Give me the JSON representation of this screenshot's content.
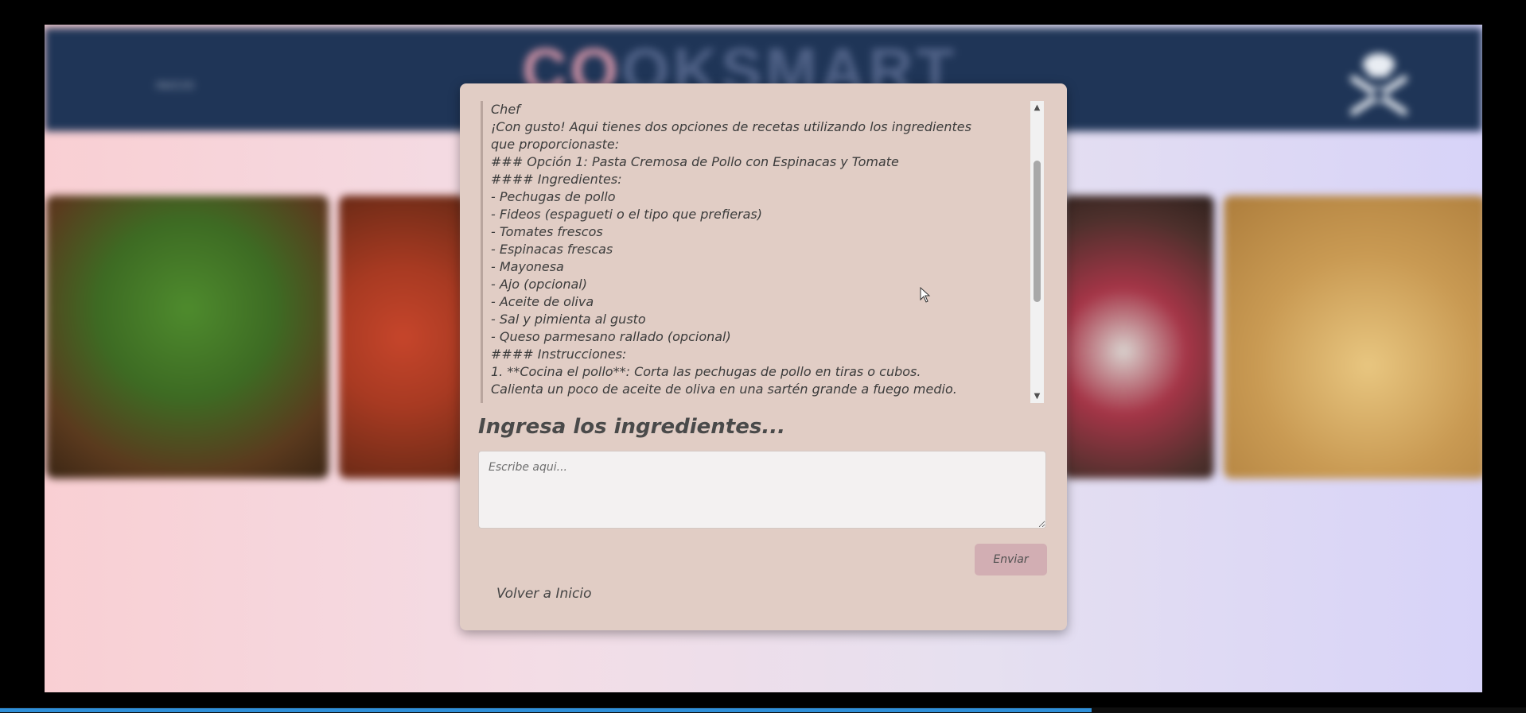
{
  "header": {
    "nav_label": "INICIO",
    "logo_text_first": "CO",
    "logo_text_rest": "OKSMART"
  },
  "chat": {
    "lines": [
      "Chef",
      "¡Con gusto! Aqui tienes dos opciones de recetas utilizando los ingredientes",
      "que proporcionaste:",
      "### Opción 1: Pasta Cremosa de Pollo con Espinacas y Tomate",
      "#### Ingredientes:",
      "- Pechugas de pollo",
      "- Fideos (espagueti o el tipo que prefieras)",
      "- Tomates frescos",
      "- Espinacas frescas",
      "- Mayonesa",
      "- Ajo (opcional)",
      "- Aceite de oliva",
      "- Sal y pimienta al gusto",
      "- Queso parmesano rallado (opcional)",
      "#### Instrucciones:",
      "1. **Cocina el pollo**: Corta las pechugas de pollo en tiras o cubos.",
      "Calienta un poco de aceite de oliva en una sartén grande a fuego medio."
    ],
    "scroll_position": 0.2
  },
  "form": {
    "heading": "Ingresa los ingredientes...",
    "input_placeholder": "Escribe aqui...",
    "input_value": "",
    "send_label": "Enviar",
    "back_label": "Volver a Inicio"
  },
  "colors": {
    "header_bg": "#1f3557",
    "panel_bg": "#e1cdc5",
    "button_bg": "#d2aeb3"
  }
}
